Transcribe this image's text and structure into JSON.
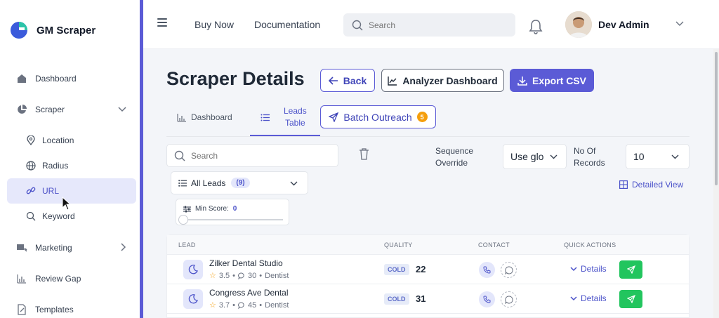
{
  "app": {
    "name": "GM Scraper"
  },
  "sidebar": {
    "items": [
      {
        "label": "Dashboard"
      },
      {
        "label": "Scraper"
      },
      {
        "label": "Location"
      },
      {
        "label": "Radius"
      },
      {
        "label": "URL"
      },
      {
        "label": "Keyword"
      },
      {
        "label": "Marketing"
      },
      {
        "label": "Review Gap"
      },
      {
        "label": "Templates"
      }
    ]
  },
  "topbar": {
    "links": [
      "Buy Now",
      "Documentation"
    ],
    "search_placeholder": "Search",
    "user_name": "Dev Admin"
  },
  "page": {
    "title": "Scraper Details",
    "back_label": "Back",
    "analyzer_label": "Analyzer Dashboard",
    "export_label": "Export CSV"
  },
  "tabs": {
    "dashboard": "Dashboard",
    "leads_line1": "Leads",
    "leads_line2": "Table",
    "batch": "Batch Outreach",
    "batch_count": "5"
  },
  "filters": {
    "search_placeholder": "Search",
    "sequence_line1": "Sequence",
    "sequence_line2": "Override",
    "sequence_value": "Use glo",
    "records_line1": "No Of",
    "records_line2": "Records",
    "records_value": "10",
    "leads_filter": "All Leads",
    "leads_count": "(9)",
    "detailed_view": "Detailed View",
    "min_score_label": "Min Score:",
    "min_score_value": "0"
  },
  "table": {
    "headers": [
      "LEAD",
      "QUALITY",
      "CONTACT",
      "QUICK ACTIONS"
    ],
    "rows": [
      {
        "name": "Zilker Dental Studio",
        "rating": "3.5",
        "reviews": "30",
        "category": "Dentist",
        "tag": "COLD",
        "score": "22",
        "action": "Details"
      },
      {
        "name": "Congress Ave Dental",
        "rating": "3.7",
        "reviews": "45",
        "category": "Dentist",
        "tag": "COLD",
        "score": "31",
        "action": "Details"
      }
    ]
  },
  "colors": {
    "accent": "#5b5bd6",
    "send": "#22c55e",
    "badge": "#f59e0b"
  }
}
